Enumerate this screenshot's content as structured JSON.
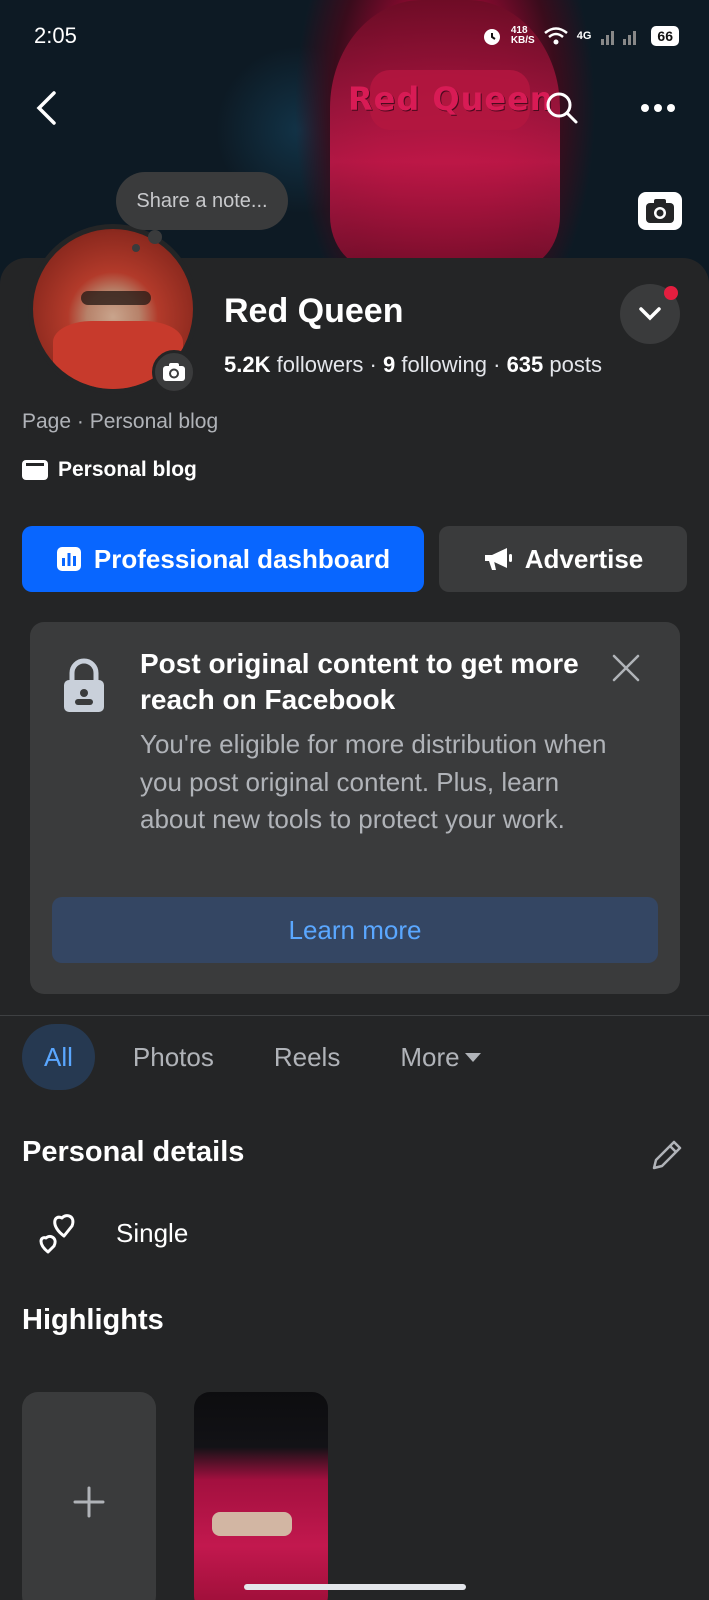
{
  "status": {
    "time": "2:05",
    "speed": "418\nKB/S",
    "network": "4G",
    "battery": "66"
  },
  "cover": {
    "title_text": "Red Queen"
  },
  "note": {
    "placeholder": "Share a note..."
  },
  "profile": {
    "name": "Red Queen",
    "followers_count": "5.2K",
    "followers_label": "followers",
    "following_count": "9",
    "following_label": "following",
    "posts_count": "635",
    "posts_label": "posts",
    "category": "Page · Personal blog",
    "page_type": "Personal blog"
  },
  "actions": {
    "dashboard_label": "Professional dashboard",
    "advertise_label": "Advertise"
  },
  "card": {
    "title": "Post original content to get more reach on Facebook",
    "body": "You're eligible for more distribution when you post original content. Plus, learn about new tools to protect your work.",
    "button_label": "Learn more"
  },
  "tabs": [
    {
      "label": "All",
      "active": true
    },
    {
      "label": "Photos",
      "active": false
    },
    {
      "label": "Reels",
      "active": false
    },
    {
      "label": "More",
      "active": false
    }
  ],
  "details": {
    "heading": "Personal details",
    "relationship": "Single"
  },
  "highlights": {
    "heading": "Highlights",
    "add_symbol": "+"
  },
  "colors": {
    "primary": "#0866ff",
    "background": "#242526",
    "card": "#3a3b3c",
    "link": "#5aa7ff",
    "notification": "#e41e3f"
  },
  "icons": [
    "back-icon",
    "search-icon",
    "more-dots-icon",
    "camera-icon",
    "chevron-down-icon",
    "page-icon",
    "dashboard-icon",
    "megaphone-icon",
    "lock-icon",
    "close-icon",
    "caret-down-icon",
    "pencil-icon",
    "hearts-icon",
    "plus-icon"
  ]
}
